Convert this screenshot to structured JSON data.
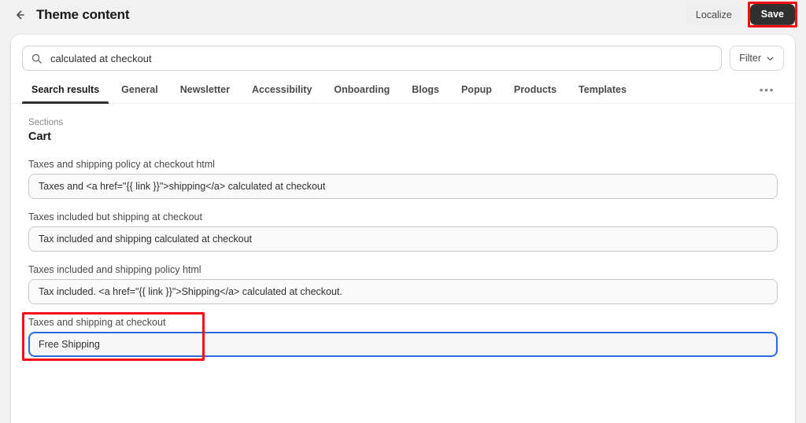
{
  "topbar": {
    "back_icon": "arrow-left-icon",
    "title": "Theme content",
    "localize_label": "Localize",
    "save_label": "Save",
    "save_bg": "#303030",
    "annotation_color": "#f50f0f"
  },
  "search": {
    "icon": "search-icon",
    "value": "calculated at checkout",
    "placeholder": "Search"
  },
  "filter": {
    "label": "Filter",
    "icon": "chevron-down-icon"
  },
  "tabs": {
    "items": [
      {
        "label": "Search results",
        "active": true
      },
      {
        "label": "General",
        "active": false
      },
      {
        "label": "Newsletter",
        "active": false
      },
      {
        "label": "Accessibility",
        "active": false
      },
      {
        "label": "Onboarding",
        "active": false
      },
      {
        "label": "Blogs",
        "active": false
      },
      {
        "label": "Popup",
        "active": false
      },
      {
        "label": "Products",
        "active": false
      },
      {
        "label": "Templates",
        "active": false
      }
    ],
    "overflow_label": "•••"
  },
  "content": {
    "sections_label": "Sections",
    "group_title": "Cart",
    "fields": [
      {
        "label": "Taxes and shipping policy at checkout html",
        "value": "Taxes and <a href=\"{{ link }}\">shipping</a> calculated at checkout",
        "focused": false,
        "annotated": false
      },
      {
        "label": "Taxes included but shipping at checkout",
        "value": "Tax included and shipping calculated at checkout",
        "focused": false,
        "annotated": false
      },
      {
        "label": "Taxes included and shipping policy html",
        "value": "Tax included. <a href=\"{{ link }}\">Shipping</a> calculated at checkout.",
        "focused": false,
        "annotated": false
      },
      {
        "label": "Taxes and shipping at checkout",
        "value": "Free Shipping",
        "focused": true,
        "annotated": true
      }
    ]
  },
  "colors": {
    "page_bg": "#f1f1f1",
    "card_bg": "#ffffff",
    "focus_blue": "#2a6ae0",
    "annotation_red": "#f50f0f",
    "text_primary": "#303030",
    "text_muted": "#8a8a8a"
  }
}
